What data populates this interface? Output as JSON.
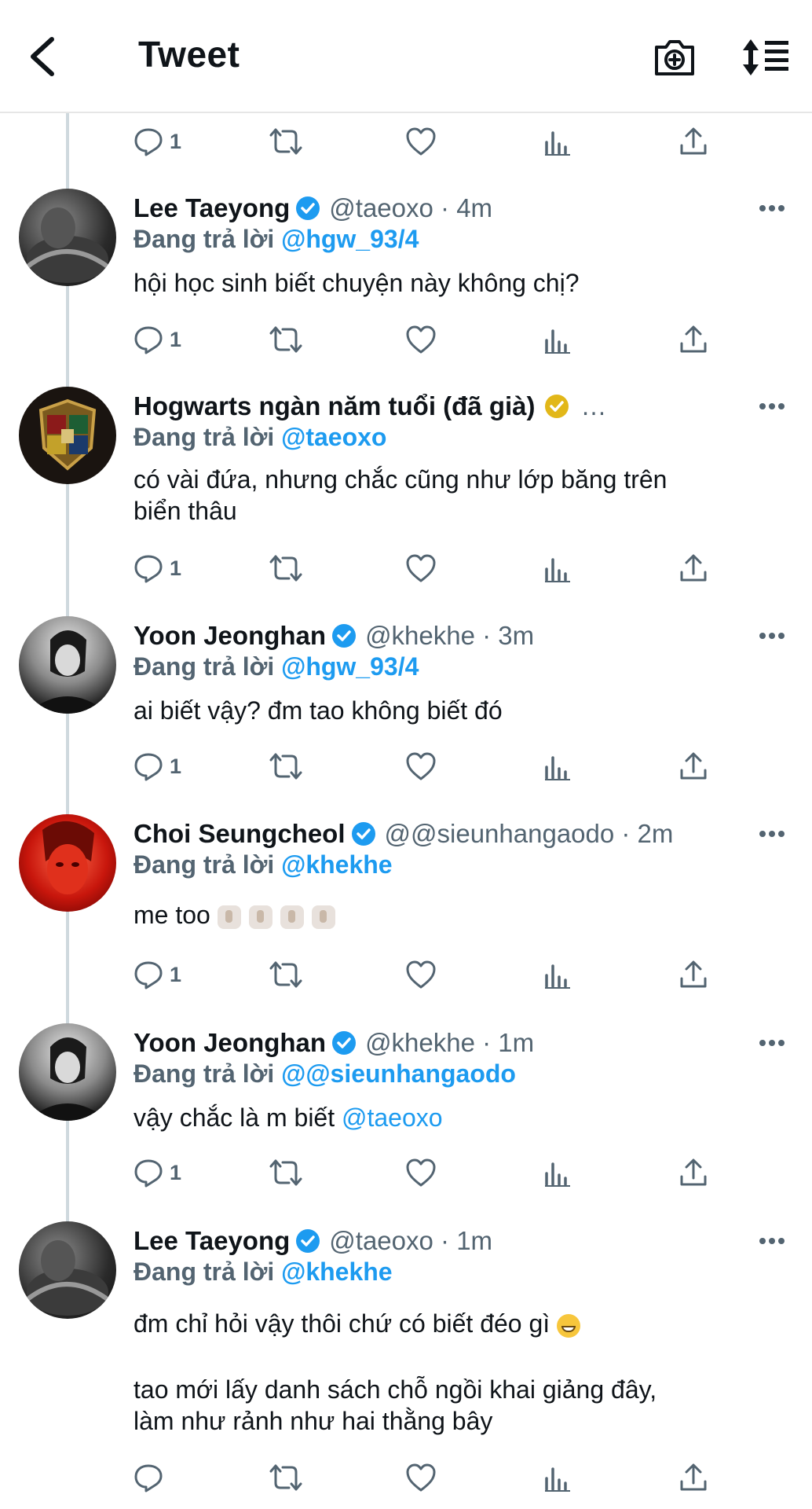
{
  "header": {
    "title": "Tweet"
  },
  "top_actions": {
    "reply_count": "1"
  },
  "tweets": [
    {
      "name": "Lee Taeyong",
      "meta": "@taeoxo · 4m",
      "reply_label": "Đang trả lời",
      "reply_to": "@hgw_93/4",
      "text": "hội học sinh biết chuyện này không chị?",
      "reply_count": "1",
      "badge_color": "#1d9bf0"
    },
    {
      "name": "Hogwarts ngàn năm tuổi (đã già)",
      "meta": "…",
      "reply_label": "Đang trả lời",
      "reply_to": "@taeoxo",
      "text": "có vài đứa, nhưng chắc cũng như lớp băng trên\nbiển thâu",
      "reply_count": "1",
      "badge_color": "#e2b719"
    },
    {
      "name": "Yoon Jeonghan",
      "meta": "@khekhe · 3m",
      "reply_label": "Đang trả lời",
      "reply_to": "@hgw_93/4",
      "text": "ai biết vậy? đm tao không biết đó",
      "reply_count": "1",
      "badge_color": "#1d9bf0"
    },
    {
      "name": "Choi Seungcheol",
      "meta": "@@sieunhangaodo · 2m",
      "reply_label": "Đang trả lời",
      "reply_to": "@khekhe",
      "text": "me too",
      "reply_count": "1",
      "badge_color": "#1d9bf0"
    },
    {
      "name": "Yoon Jeonghan",
      "meta": "@khekhe · 1m",
      "reply_label": "Đang trả lời",
      "reply_to": "@@sieunhangaodo",
      "text": "vậy chắc là m biết ",
      "mention": "@taeoxo",
      "reply_count": "1",
      "badge_color": "#1d9bf0"
    },
    {
      "name": "Lee Taeyong",
      "meta": "@taeoxo · 1m",
      "reply_label": "Đang trả lời",
      "reply_to": "@khekhe",
      "text": "đm chỉ hỏi vậy thôi chứ có biết đéo gì",
      "text2": "tao mới lấy danh sách chỗ ngồi khai giảng đây,\nlàm như rảnh như hai thằng bây",
      "reply_count": "",
      "badge_color": "#1d9bf0"
    }
  ],
  "icons": {
    "back": "chevron-left-icon",
    "camera": "camera-plus-icon",
    "sort": "sort-icon",
    "reply": "reply-icon",
    "retweet": "retweet-icon",
    "like": "heart-icon",
    "views": "analytics-icon",
    "share": "share-icon",
    "more": "more-icon",
    "verified": "verified-badge-icon"
  }
}
